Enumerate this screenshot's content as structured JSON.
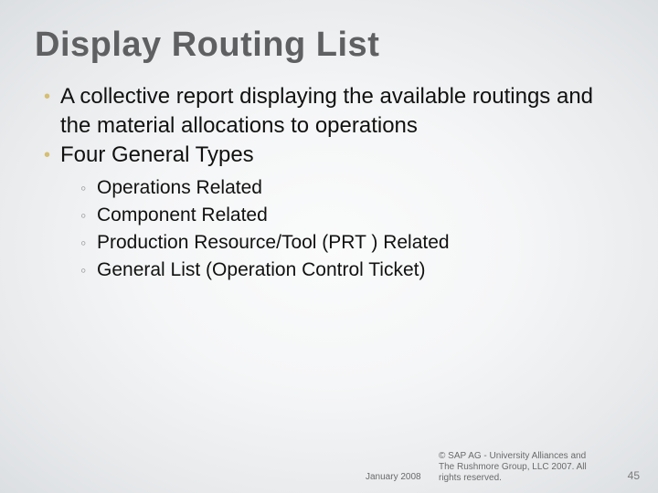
{
  "title": "Display Routing List",
  "bullets": [
    {
      "text": "A collective report displaying the available routings and the material allocations to operations"
    },
    {
      "text": "Four General Types"
    }
  ],
  "sub_bullets": [
    {
      "text": "Operations Related"
    },
    {
      "text": "Component Related"
    },
    {
      "text": "Production Resource/Tool (PRT ) Related"
    },
    {
      "text": "General List (Operation Control Ticket)"
    }
  ],
  "footer": {
    "date": "January 2008",
    "copyright": "© SAP AG - University Alliances and The Rushmore Group, LLC 2007. All rights reserved.",
    "page": "45"
  },
  "markers": {
    "bullet": "•",
    "sub": "◦"
  }
}
